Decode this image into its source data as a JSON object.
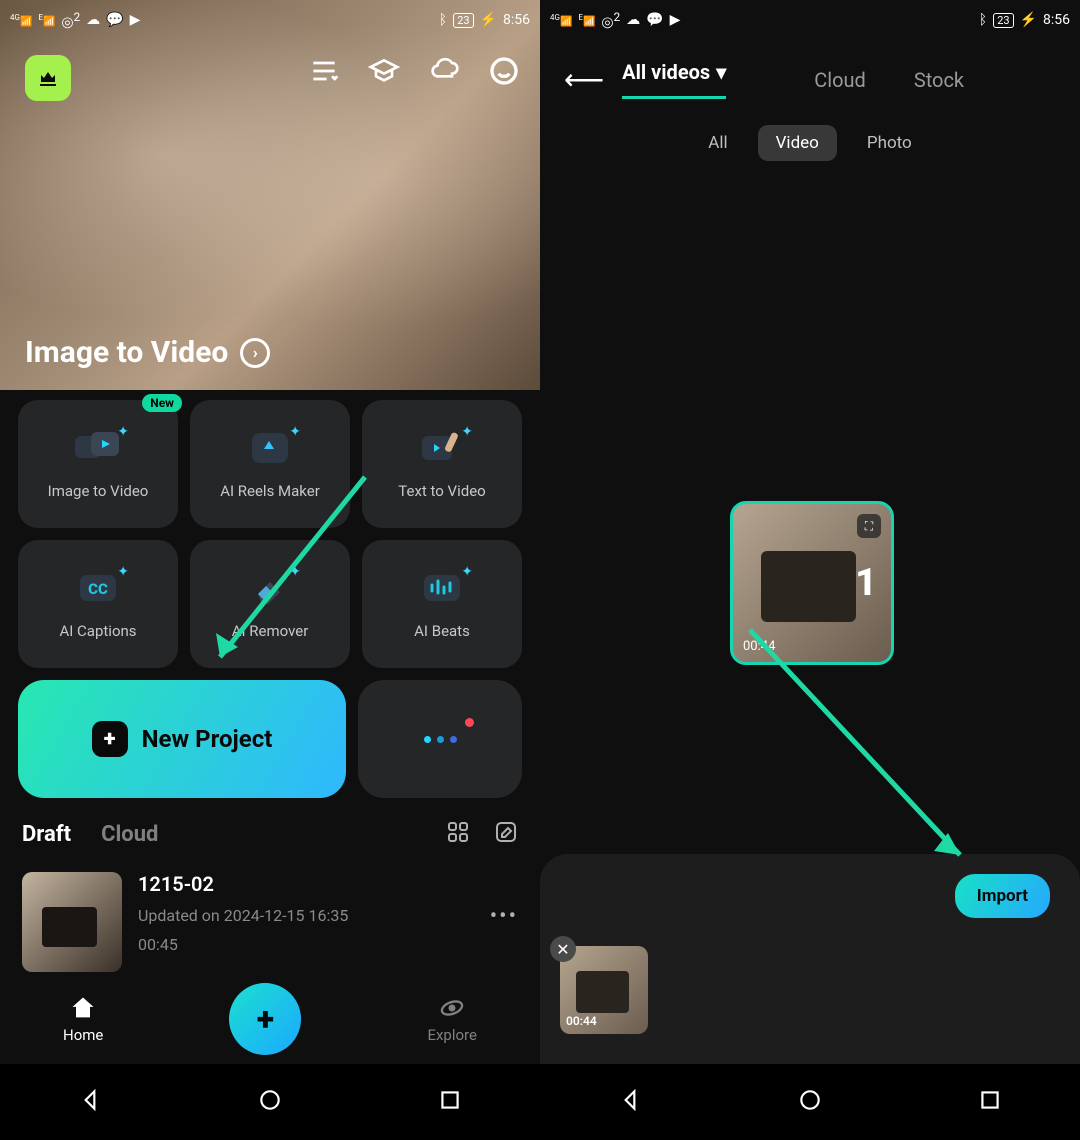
{
  "status": {
    "time": "8:56",
    "battery": "23"
  },
  "left": {
    "hero_title": "Image to Video",
    "tiles": [
      {
        "label": "Image to Video",
        "badge": "New"
      },
      {
        "label": "AI Reels Maker"
      },
      {
        "label": "Text to Video"
      },
      {
        "label": "AI Captions"
      },
      {
        "label": "AI Remover"
      },
      {
        "label": "AI Beats"
      }
    ],
    "new_project": "New Project",
    "draft_tabs": {
      "active": "Draft",
      "inactive": "Cloud"
    },
    "draft": {
      "name": "1215-02",
      "updated": "Updated on 2024-12-15 16:35",
      "duration": "00:45"
    },
    "nav": {
      "home": "Home",
      "explore": "Explore"
    }
  },
  "right": {
    "tabs": {
      "primary": "All videos",
      "cloud": "Cloud",
      "stock": "Stock"
    },
    "filters": {
      "all": "All",
      "video": "Video",
      "photo": "Photo"
    },
    "video": {
      "selected_index": "1",
      "duration": "00:44"
    },
    "tray": {
      "duration": "00:44",
      "import": "Import"
    }
  }
}
